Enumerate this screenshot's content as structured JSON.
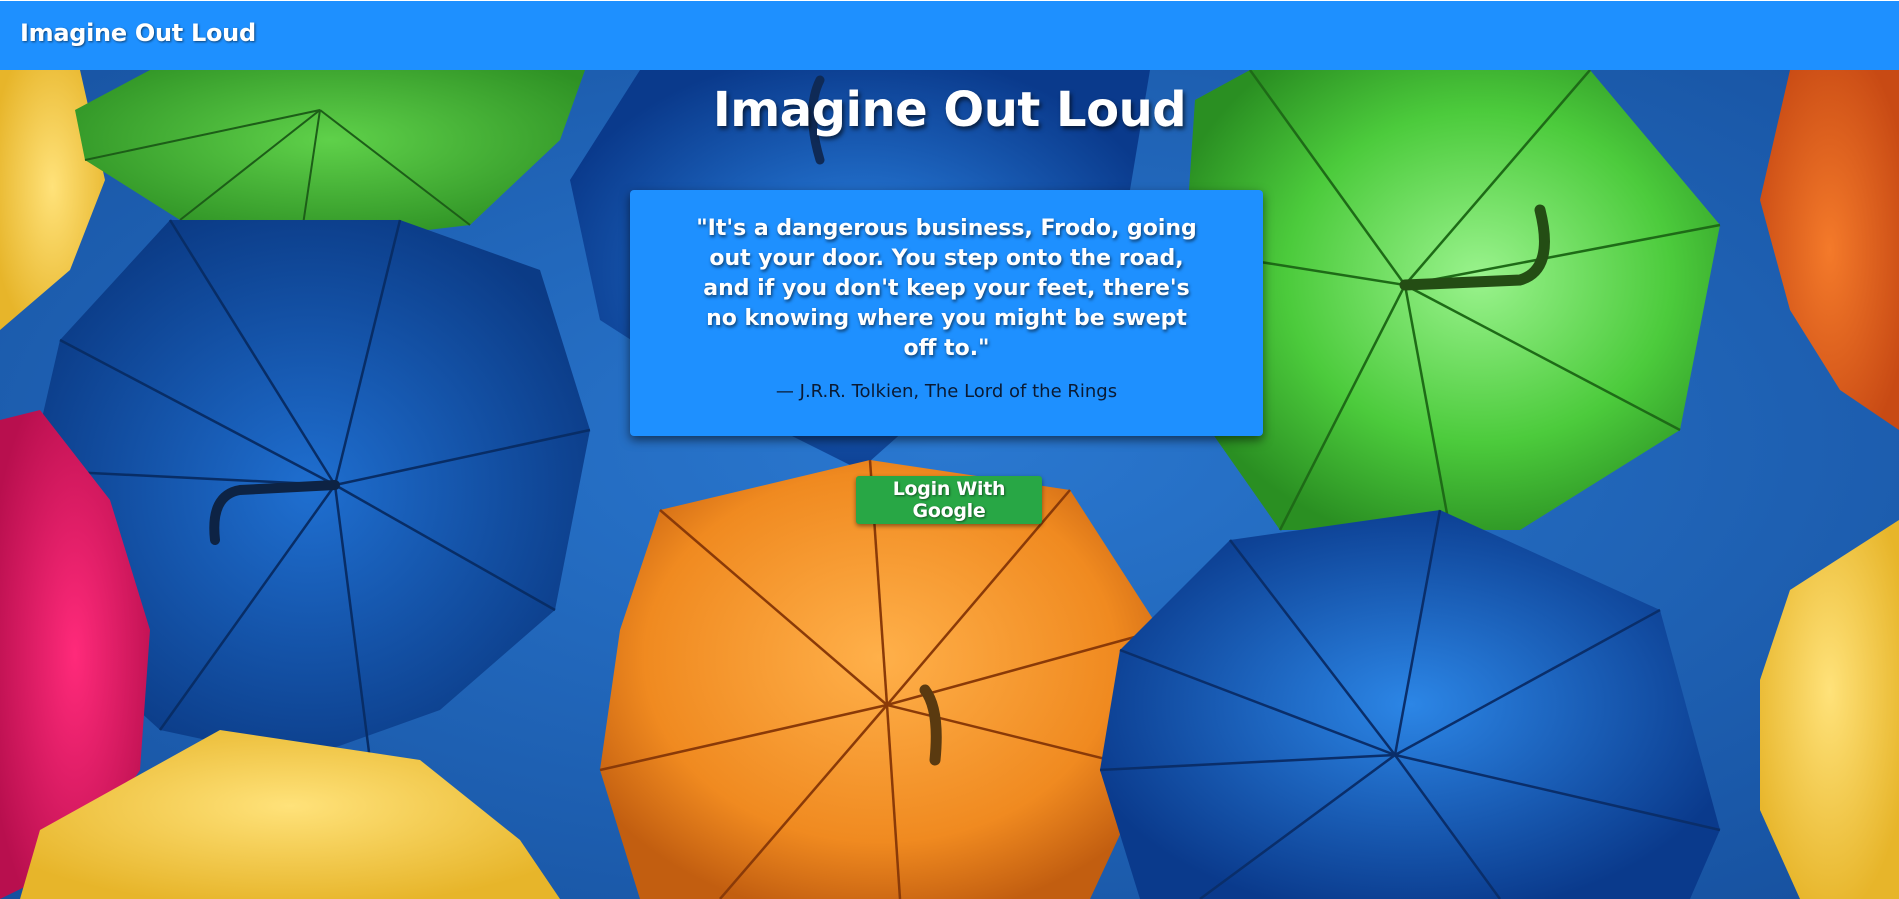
{
  "navbar": {
    "brand": "Imagine Out Loud"
  },
  "hero": {
    "title": "Imagine Out Loud"
  },
  "quote": {
    "text": "\"It's a dangerous business, Frodo, going out your door. You step onto the road, and if you don't keep your feet, there's no knowing where you might be swept off to.\"",
    "author": "— J.R.R. Tolkien, The Lord of the Rings"
  },
  "login": {
    "label": "Login With Google"
  },
  "colors": {
    "navbar": "#1e90ff",
    "card": "#1e90ff",
    "button": "#28a745",
    "sky": "#1c5fb8"
  }
}
